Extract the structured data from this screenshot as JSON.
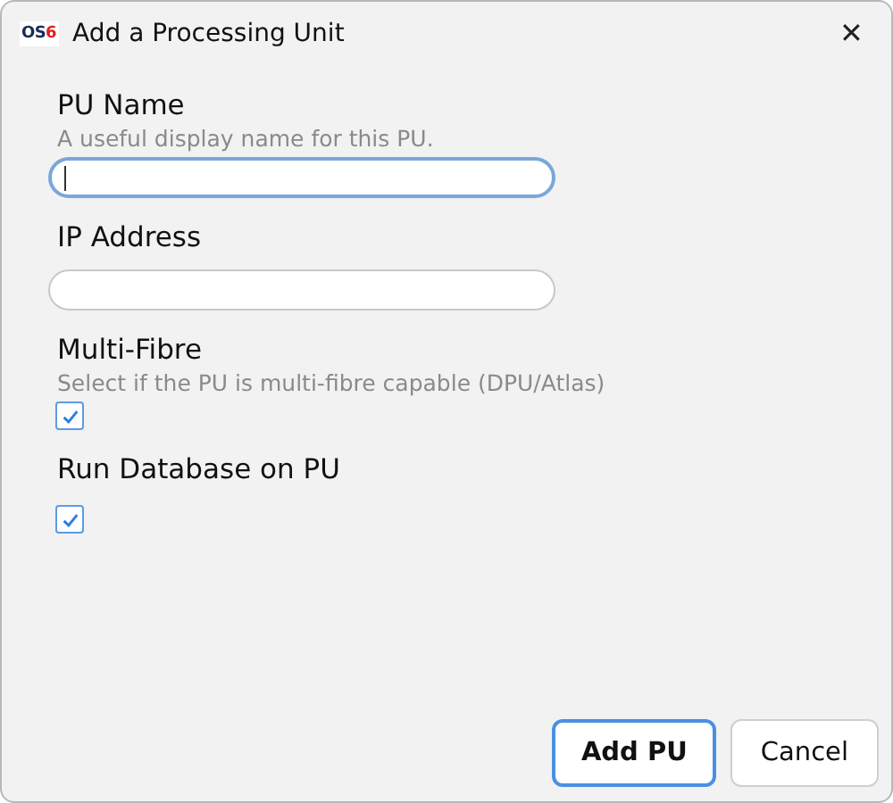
{
  "window": {
    "logo": {
      "text": "OS",
      "accent": "6"
    },
    "title": "Add a Processing Unit",
    "close": "✕"
  },
  "fields": [
    {
      "kind": "text",
      "label": "PU Name",
      "hint": "A useful display name for this PU.",
      "focused": true
    },
    {
      "kind": "text",
      "label": "IP Address",
      "focused": false
    },
    {
      "kind": "checkbox",
      "label": "Multi-Fibre",
      "hint": "Select if the PU is multi-fibre capable (DPU/Atlas)",
      "checked": true
    },
    {
      "kind": "checkbox",
      "label": "Run Database on PU",
      "checked": true
    }
  ],
  "buttons": [
    {
      "label": "Add PU",
      "primary": true
    },
    {
      "label": "Cancel",
      "primary": false
    }
  ]
}
